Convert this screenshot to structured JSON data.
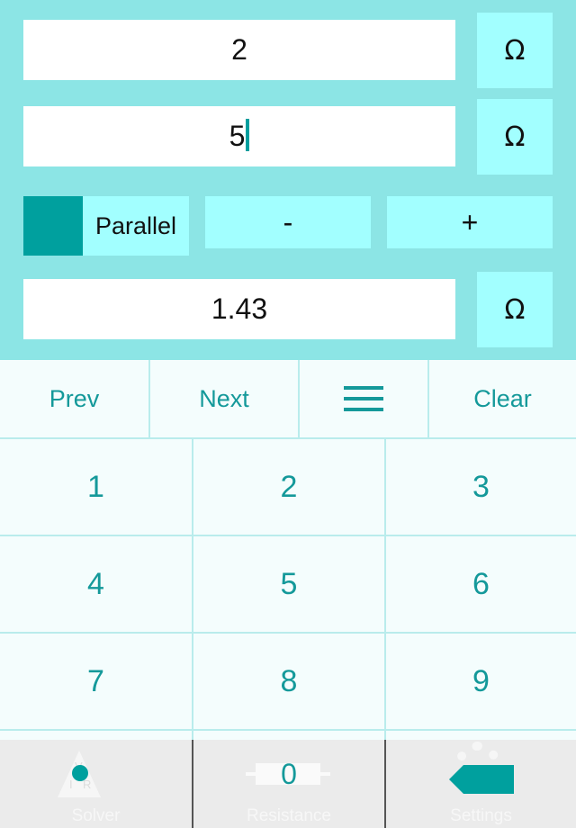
{
  "inputs": {
    "resistor1": {
      "value": "2",
      "unit": "Ω"
    },
    "resistor2": {
      "value": "5",
      "unit": "Ω",
      "focused": true
    },
    "result": {
      "value": "1.43",
      "unit": "Ω"
    }
  },
  "mode": {
    "label": "Parallel",
    "swatch_color": "#00a09e"
  },
  "operators": {
    "minus": "-",
    "plus": "+"
  },
  "toolbar": {
    "prev": "Prev",
    "next": "Next",
    "menu_icon": "hamburger-icon",
    "clear": "Clear"
  },
  "keypad": {
    "rows": [
      [
        "1",
        "2",
        "3"
      ],
      [
        "4",
        "5",
        "6"
      ],
      [
        "7",
        "8",
        "9"
      ]
    ],
    "bottom": {
      "decimal": "•",
      "zero": "0",
      "backspace_icon": "backspace-icon"
    }
  },
  "tabbar": {
    "tabs": [
      {
        "label": "Solver",
        "icon": "vir-triangle-icon",
        "letters": [
          "V",
          "I",
          "R"
        ]
      },
      {
        "label": "Resistance",
        "icon": "resistor-icon"
      },
      {
        "label": "Settings",
        "icon": "gear-icon"
      }
    ]
  },
  "colors": {
    "panel_bg": "#8ce5e5",
    "button_bg": "#a2ffff",
    "accent": "#00a09e",
    "key_text": "#14999a",
    "keypad_bg": "#f4fdfd",
    "tabbar_bg": "#ebebeb"
  }
}
